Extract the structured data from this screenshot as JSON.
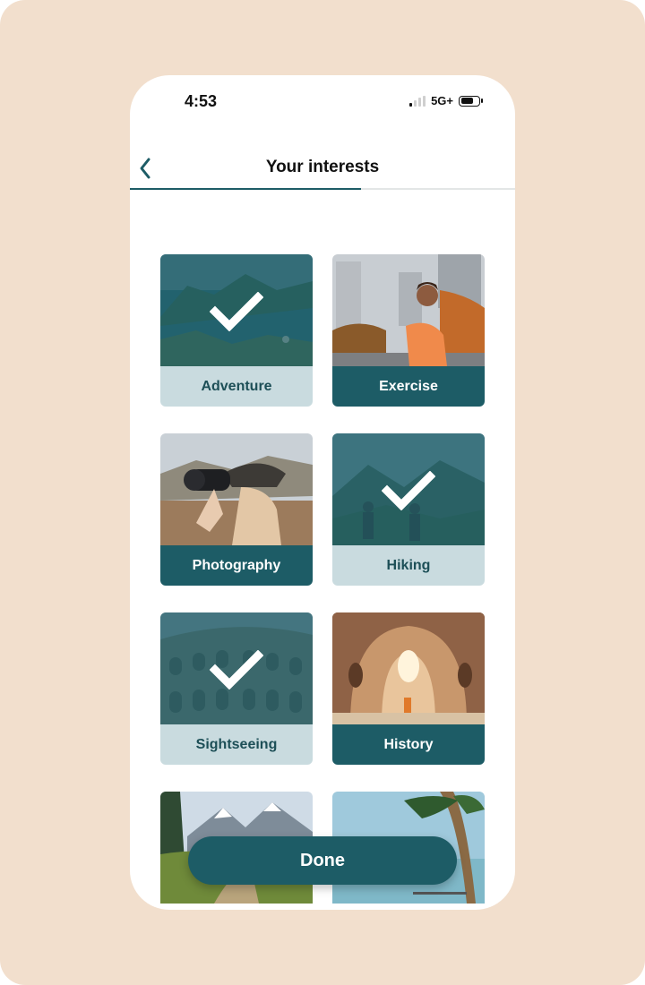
{
  "status_bar": {
    "time": "4:53",
    "network": "5G+"
  },
  "header": {
    "title": "Your interests",
    "progress": 0.6
  },
  "interests": [
    {
      "label": "Adventure",
      "selected": true
    },
    {
      "label": "Exercise",
      "selected": false
    },
    {
      "label": "Photography",
      "selected": false
    },
    {
      "label": "Hiking",
      "selected": true
    },
    {
      "label": "Sightseeing",
      "selected": true
    },
    {
      "label": "History",
      "selected": false
    },
    {
      "label": "",
      "selected": false
    },
    {
      "label": "",
      "selected": false
    }
  ],
  "done_button": {
    "label": "Done"
  },
  "colors": {
    "accent": "#1d5c66",
    "selected_band": "#c9dbdf",
    "backdrop": "#f2dfcd"
  }
}
